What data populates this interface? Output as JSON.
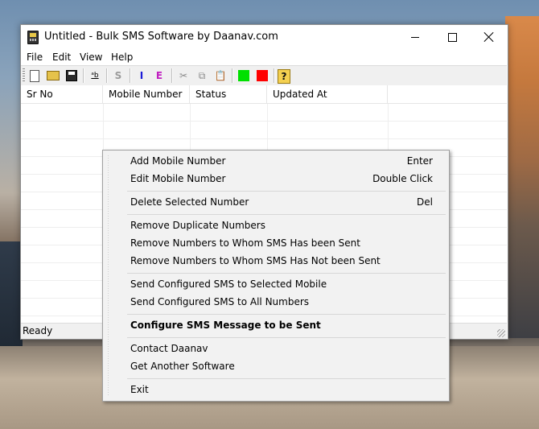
{
  "window": {
    "title": "Untitled - Bulk SMS Software by Daanav.com"
  },
  "menu": [
    "File",
    "Edit",
    "View",
    "Help"
  ],
  "toolbar": {
    "button_labels": [
      "ᵃb",
      "S",
      "I",
      "E",
      "?"
    ],
    "colors": {
      "i_color": "#1a1ad8",
      "e_color": "#c020c0",
      "green": "#00e000",
      "red": "#ff0000",
      "s_color": "#9a9a9a"
    },
    "icons": [
      "new-file-icon",
      "open-folder-icon",
      "save-disk-icon",
      "text-format-icon",
      "cut-icon",
      "copy-icon",
      "paste-icon"
    ]
  },
  "grid": {
    "columns": [
      "Sr No",
      "Mobile Number",
      "Status",
      "Updated At"
    ]
  },
  "status": "Ready",
  "context_menu": {
    "groups": [
      [
        {
          "label": "Add Mobile Number",
          "shortcut": "Enter"
        },
        {
          "label": "Edit Mobile Number",
          "shortcut": "Double Click"
        }
      ],
      [
        {
          "label": "Delete Selected Number",
          "shortcut": "Del"
        }
      ],
      [
        {
          "label": "Remove Duplicate Numbers"
        },
        {
          "label": "Remove Numbers to Whom SMS Has been Sent"
        },
        {
          "label": "Remove Numbers to Whom SMS Has Not been Sent"
        }
      ],
      [
        {
          "label": "Send Configured SMS to Selected Mobile"
        },
        {
          "label": "Send Configured SMS to All Numbers"
        }
      ],
      [
        {
          "label": "Configure SMS Message to be Sent",
          "bold": true
        }
      ],
      [
        {
          "label": "Contact Daanav"
        },
        {
          "label": "Get Another Software"
        }
      ],
      [
        {
          "label": "Exit"
        }
      ]
    ]
  }
}
